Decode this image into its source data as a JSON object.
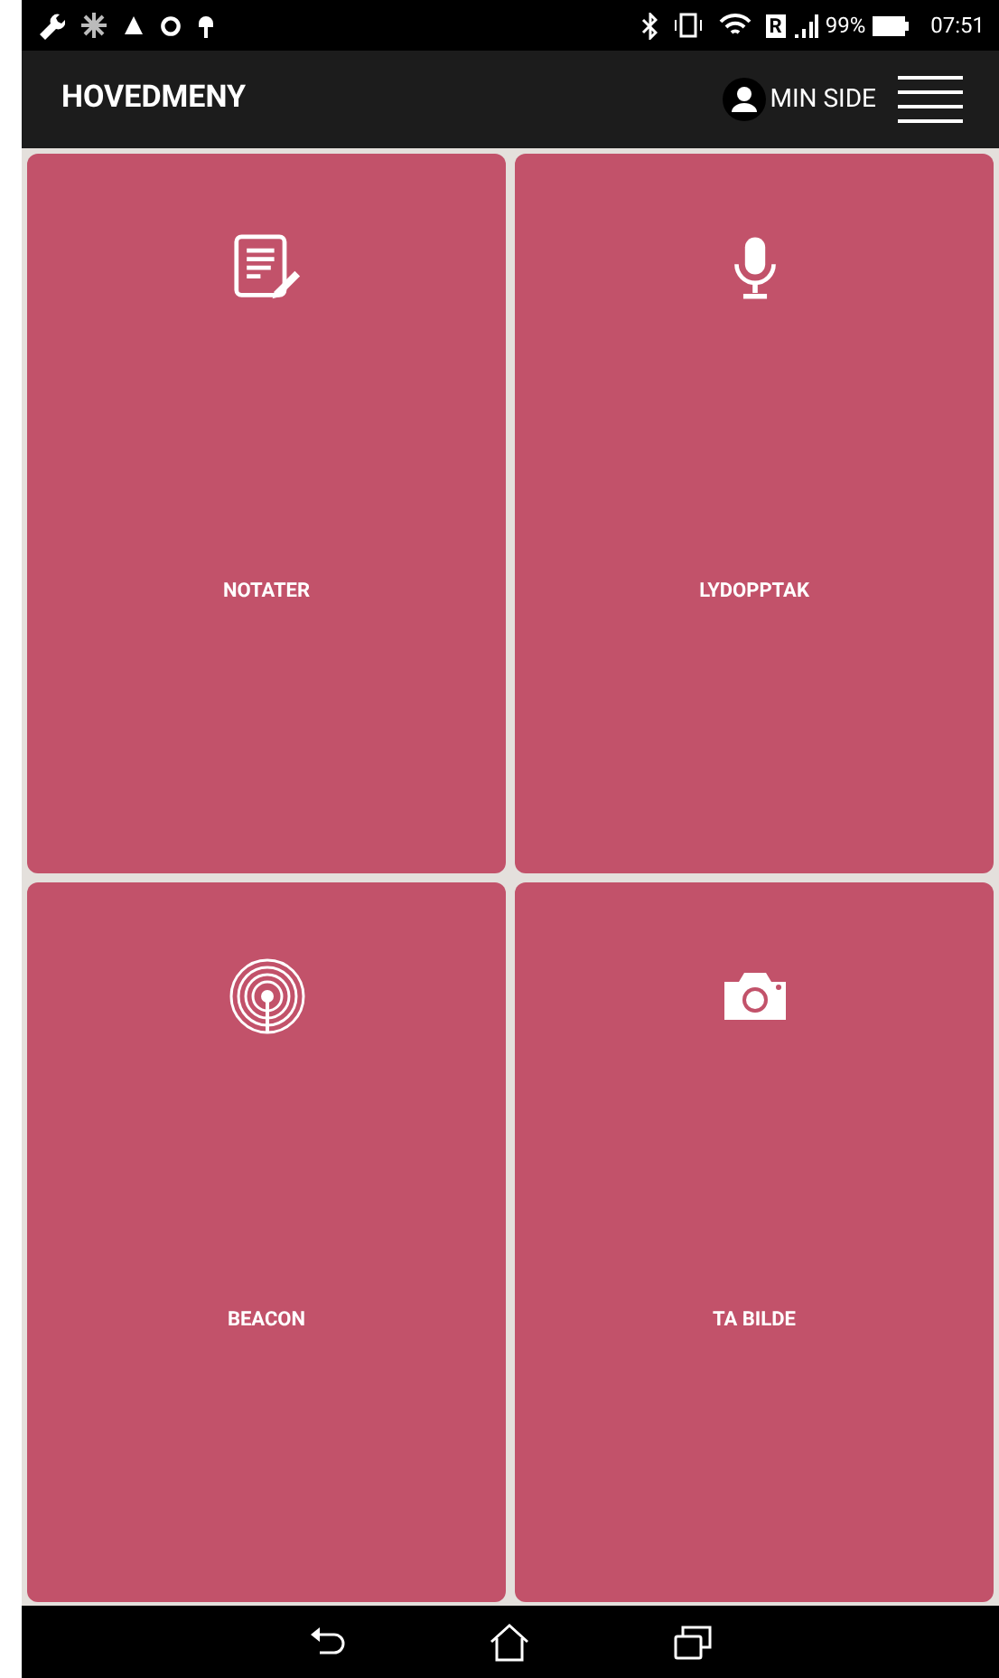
{
  "status_bar": {
    "roaming": "R",
    "battery": "99%",
    "time": "07:51"
  },
  "app_bar": {
    "title": "HOVEDMENY",
    "profile_link": "MIN SIDE"
  },
  "tiles": [
    {
      "kind": "notes",
      "label": "NOTATER"
    },
    {
      "kind": "microphone",
      "label": "LYDOPPTAK"
    },
    {
      "kind": "beacon",
      "label": "BEACON"
    },
    {
      "kind": "camera",
      "label": "TA BILDE"
    }
  ]
}
